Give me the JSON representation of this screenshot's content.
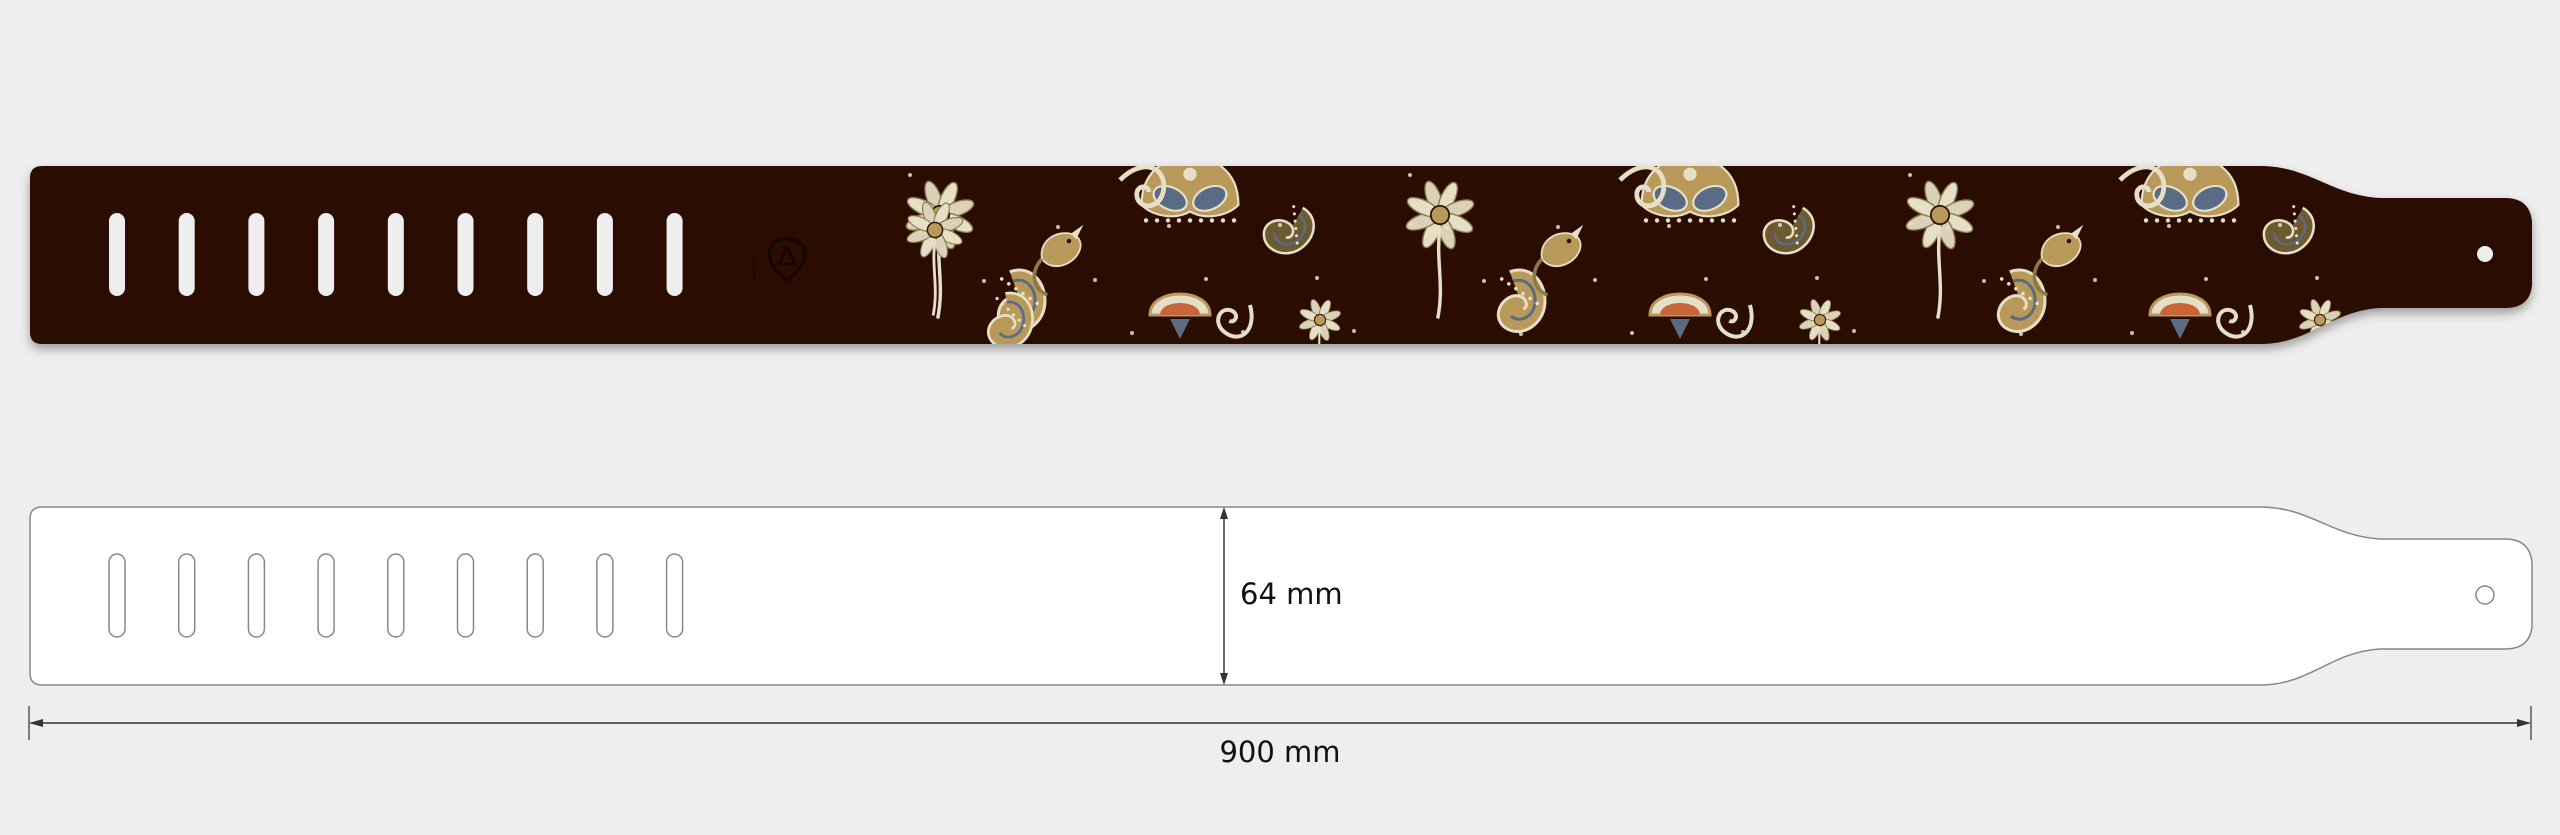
{
  "colors": {
    "background": "#eeeeee",
    "strap_leather": "#2a0e06",
    "pattern_gold": "#b8995a",
    "pattern_cream": "#e6dfc8",
    "pattern_blue": "#5a6b86",
    "outline": "#888888",
    "dimension_line": "#333333"
  },
  "strap_preview": {
    "slot_count": 9,
    "logo": "guitar-pick-logo-icon",
    "pattern": "paisley-floral-print"
  },
  "template": {
    "slot_count": 9,
    "end_hole": "circle-hole-icon"
  },
  "dimensions": {
    "width_label": "64 mm",
    "length_label": "900 mm"
  }
}
